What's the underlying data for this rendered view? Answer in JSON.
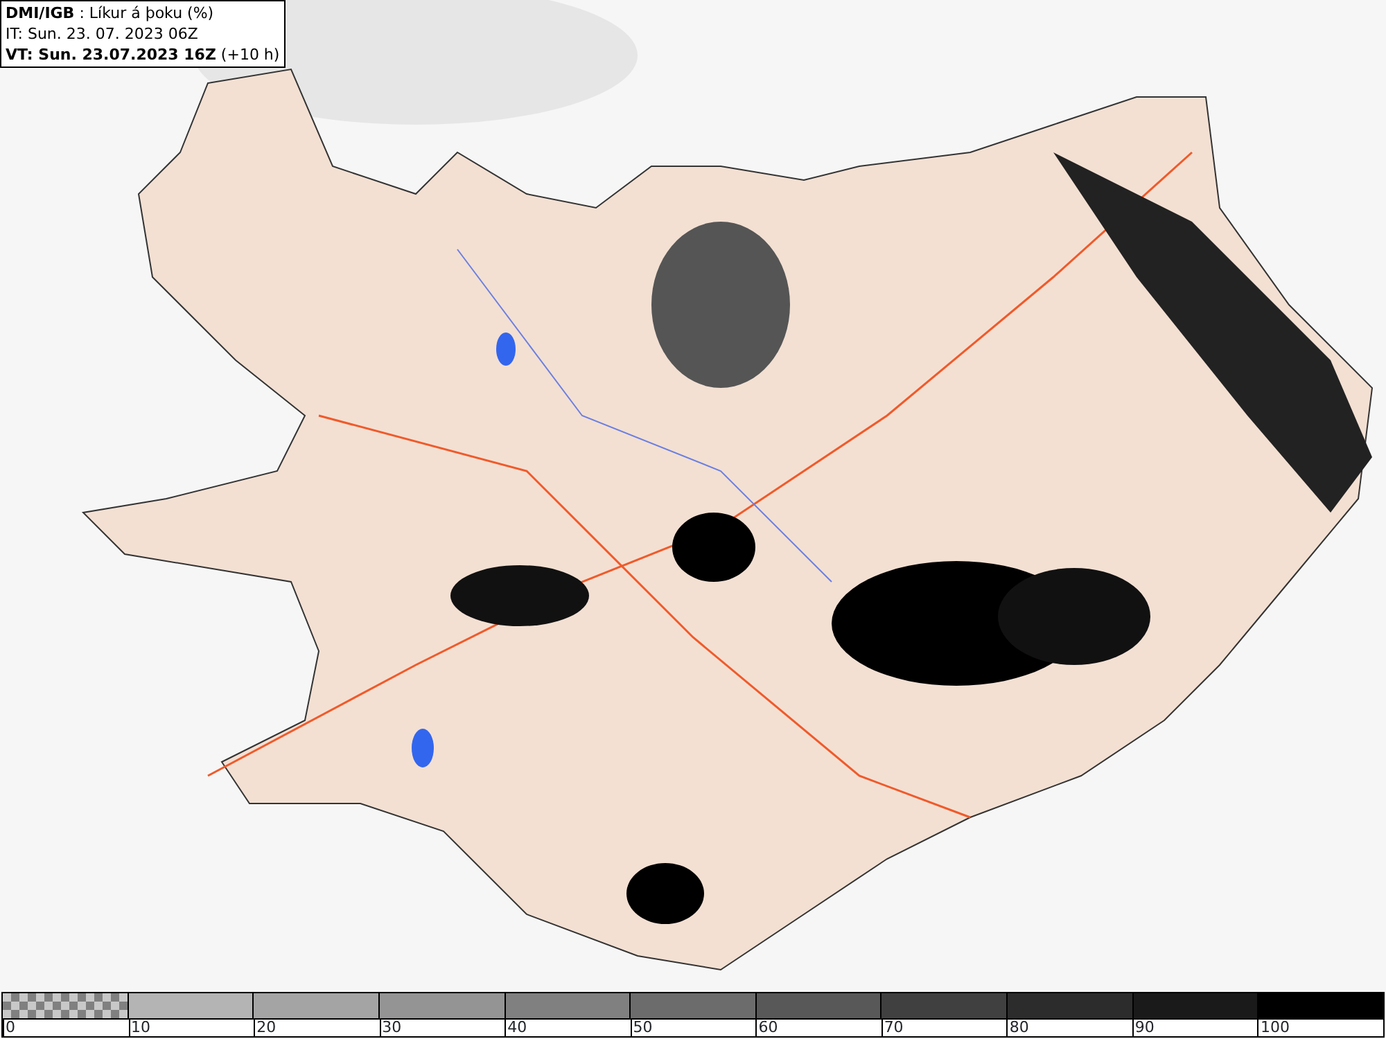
{
  "header": {
    "lines": [
      "**DMI/IGB** : Líkur á þoku (%)",
      "IT: Sun. 23. 07. 2023 06Z",
      "**VT: Sun. 23.07.2023 16Z** (+10 h)"
    ]
  },
  "legend": {
    "bins": [
      {
        "kind": "checker",
        "color": "#808080"
      },
      {
        "kind": "solid",
        "color": "#b4b4b4"
      },
      {
        "kind": "solid",
        "color": "#a4a4a4"
      },
      {
        "kind": "solid",
        "color": "#949494"
      },
      {
        "kind": "solid",
        "color": "#808080"
      },
      {
        "kind": "solid",
        "color": "#6c6c6c"
      },
      {
        "kind": "solid",
        "color": "#585858"
      },
      {
        "kind": "solid",
        "color": "#404040"
      },
      {
        "kind": "solid",
        "color": "#2c2c2c"
      },
      {
        "kind": "solid",
        "color": "#1a1a1a"
      },
      {
        "kind": "solid",
        "color": "#000000"
      }
    ],
    "ticks": [
      "0",
      "10",
      "20",
      "30",
      "40",
      "50",
      "60",
      "70",
      "80",
      "90",
      "100"
    ]
  }
}
